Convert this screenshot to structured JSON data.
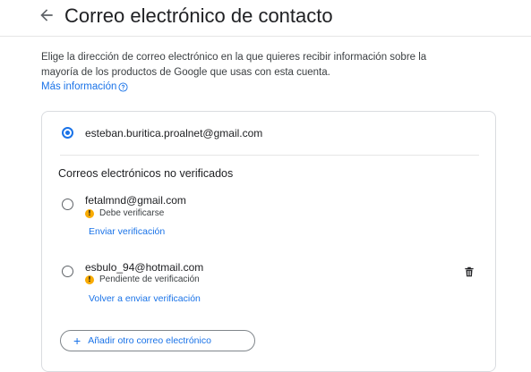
{
  "header": {
    "back_icon": "arrow-back-icon",
    "title": "Correo electrónico de contacto"
  },
  "intro": {
    "description": "Elige la dirección de correo electrónico en la que quieres recibir información sobre la mayoría de los productos de Google que usas con esta cuenta.",
    "more_info_label": "Más información",
    "help_icon": "help-circle-icon"
  },
  "selected_email": {
    "address": "esteban.buritica.proalnet@gmail.com",
    "checked": true
  },
  "unverified": {
    "section_title": "Correos electrónicos no verificados",
    "items": [
      {
        "address": "fetalmnd@gmail.com",
        "status": "Debe verificarse",
        "action": "Enviar verificación",
        "checked": false
      },
      {
        "address": "esbulo_94@hotmail.com",
        "status": "Pendiente de verificación",
        "action": "Volver a enviar verificación",
        "checked": false,
        "delete_icon": "trash-icon"
      }
    ]
  },
  "add_button": {
    "icon": "plus-icon",
    "label": "Añadir otro correo electrónico"
  },
  "colors": {
    "accent": "#1a73e8",
    "warning": "#f9ab00",
    "text": "#202124",
    "border": "#dadce0"
  }
}
